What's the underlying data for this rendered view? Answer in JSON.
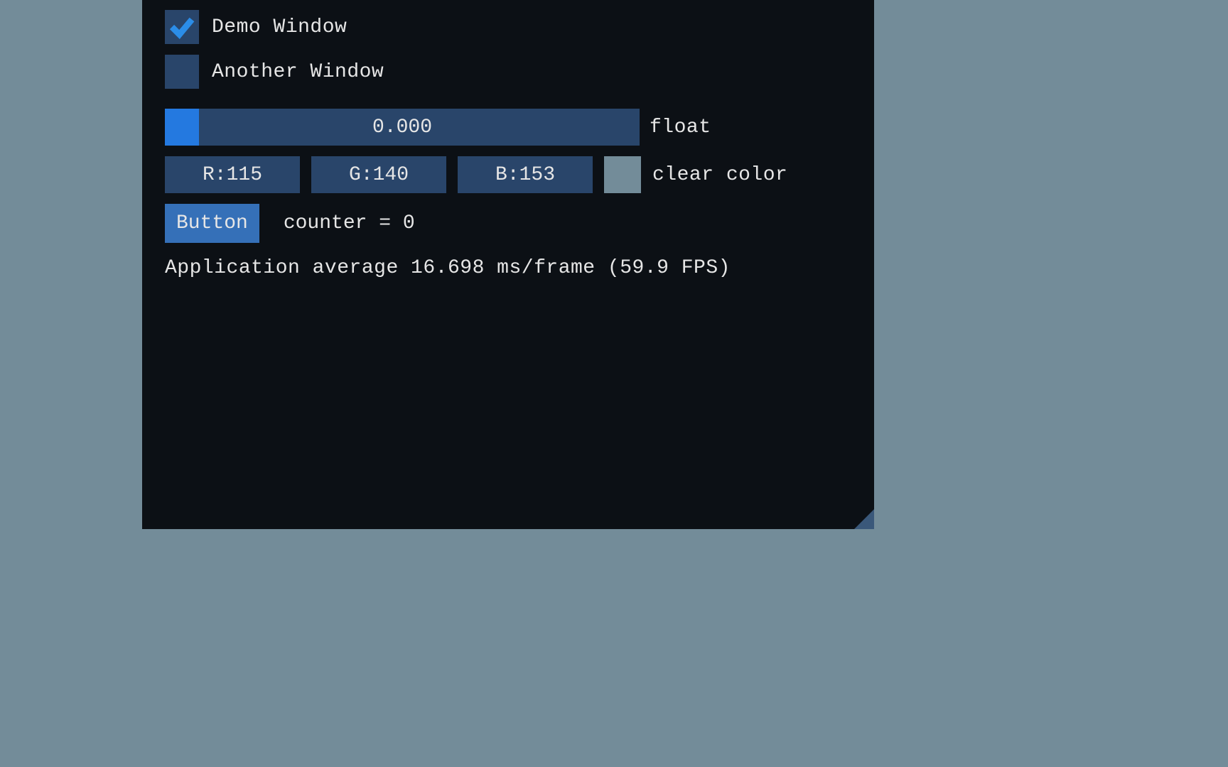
{
  "checkboxes": {
    "demo_window": {
      "label": "Demo Window",
      "checked": true
    },
    "another_window": {
      "label": "Another Window",
      "checked": false
    }
  },
  "slider": {
    "value_text": "0.000",
    "label": "float"
  },
  "color_edit": {
    "r": "R:115",
    "g": "G:140",
    "b": "B:153",
    "swatch_hex": "#738c99",
    "label": "clear color"
  },
  "button": {
    "label": "Button",
    "counter_text": "counter = 0"
  },
  "stats": {
    "text": "Application average 16.698 ms/frame (59.9 FPS)"
  }
}
